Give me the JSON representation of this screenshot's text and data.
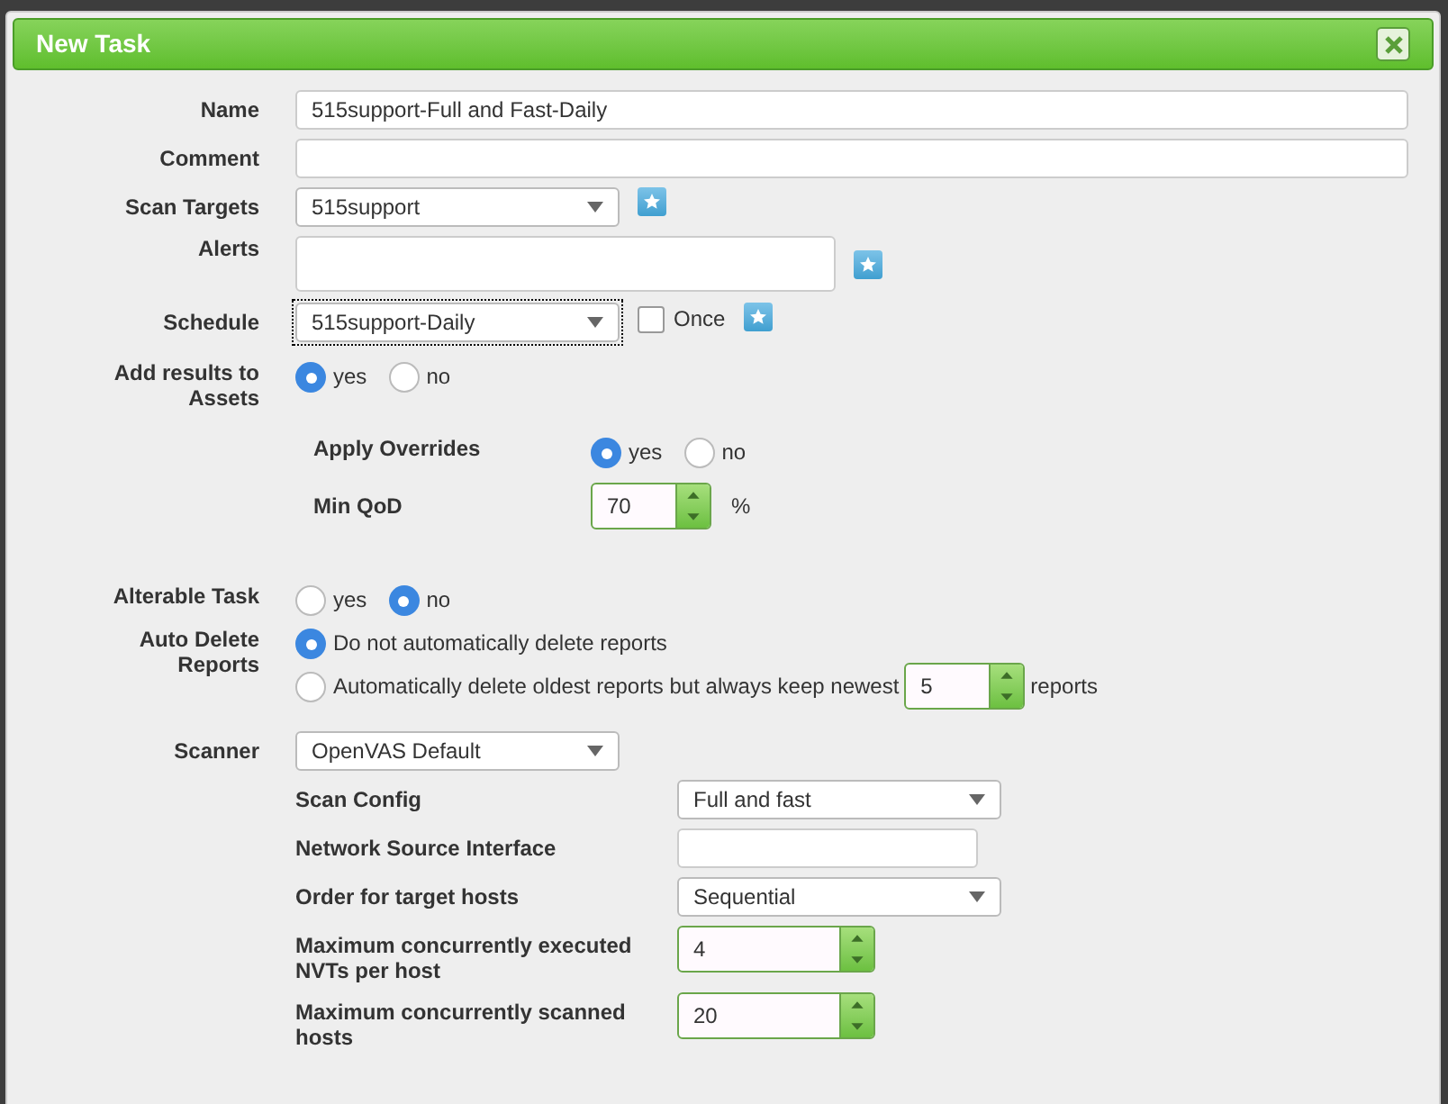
{
  "dialog": {
    "title": "New Task"
  },
  "name": {
    "label": "Name",
    "value": "515support-Full and Fast-Daily"
  },
  "comment": {
    "label": "Comment"
  },
  "scan_targets": {
    "label": "Scan Targets",
    "value": "515support"
  },
  "alerts": {
    "label": "Alerts"
  },
  "schedule": {
    "label": "Schedule",
    "value": "515support-Daily",
    "once": {
      "label": "Once",
      "checked": false
    }
  },
  "add_to_assets": {
    "label": "Add results to Assets",
    "options": [
      {
        "label": "yes",
        "selected": true
      },
      {
        "label": "no",
        "selected": false
      }
    ]
  },
  "apply_overrides": {
    "label": "Apply Overrides",
    "options": [
      {
        "label": "yes",
        "selected": true
      },
      {
        "label": "no",
        "selected": false
      }
    ]
  },
  "min_qod": {
    "label": "Min QoD",
    "value": "70",
    "unit": "%"
  },
  "alterable_task": {
    "label": "Alterable Task",
    "options": [
      {
        "label": "yes",
        "selected": false
      },
      {
        "label": "no",
        "selected": true
      }
    ]
  },
  "auto_delete": {
    "label": "Auto Delete Reports",
    "options": [
      {
        "label": "Do not automatically delete reports",
        "selected": true
      },
      {
        "label": "Automatically delete oldest reports but always keep newest",
        "selected": false,
        "value": "5",
        "unit": "reports"
      }
    ]
  },
  "scanner": {
    "label": "Scanner",
    "value": "OpenVAS Default",
    "settings": [
      {
        "kind": "select",
        "label": "Scan Config",
        "value": "Full and fast"
      },
      {
        "kind": "input",
        "label": "Network Source Interface"
      },
      {
        "kind": "select",
        "label": "Order for target hosts",
        "value": "Sequential"
      },
      {
        "kind": "spinner",
        "label": "Maximum concurrently executed NVTs per host",
        "value": "4"
      },
      {
        "kind": "spinner",
        "label": "Maximum concurrently scanned hosts",
        "value": "20"
      }
    ]
  }
}
